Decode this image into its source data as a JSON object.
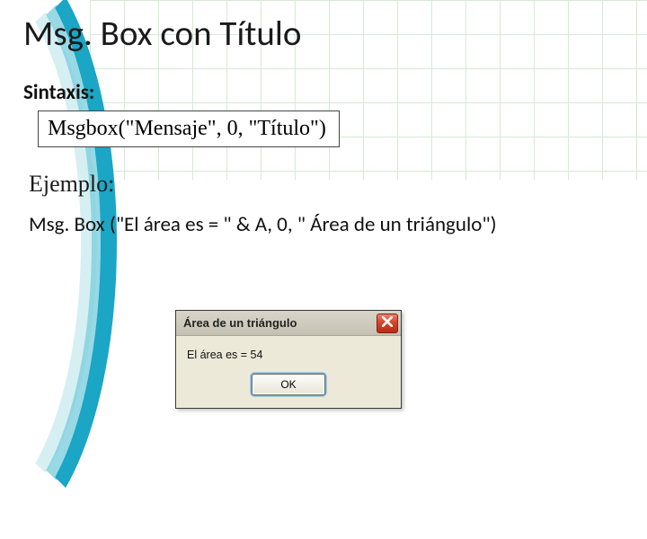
{
  "slide": {
    "title": "Msg. Box con Título",
    "syntax_label": "Sintaxis:",
    "syntax_code": "Msgbox(\"Mensaje\", 0, \"Título\")",
    "example_label": "Ejemplo:",
    "example_code": "Msg. Box (\"El área es =  \" & A, 0, \" Área de un triángulo\")"
  },
  "dialog": {
    "title": "Área de un triángulo",
    "message": "El área es = 54",
    "ok_label": "OK"
  }
}
